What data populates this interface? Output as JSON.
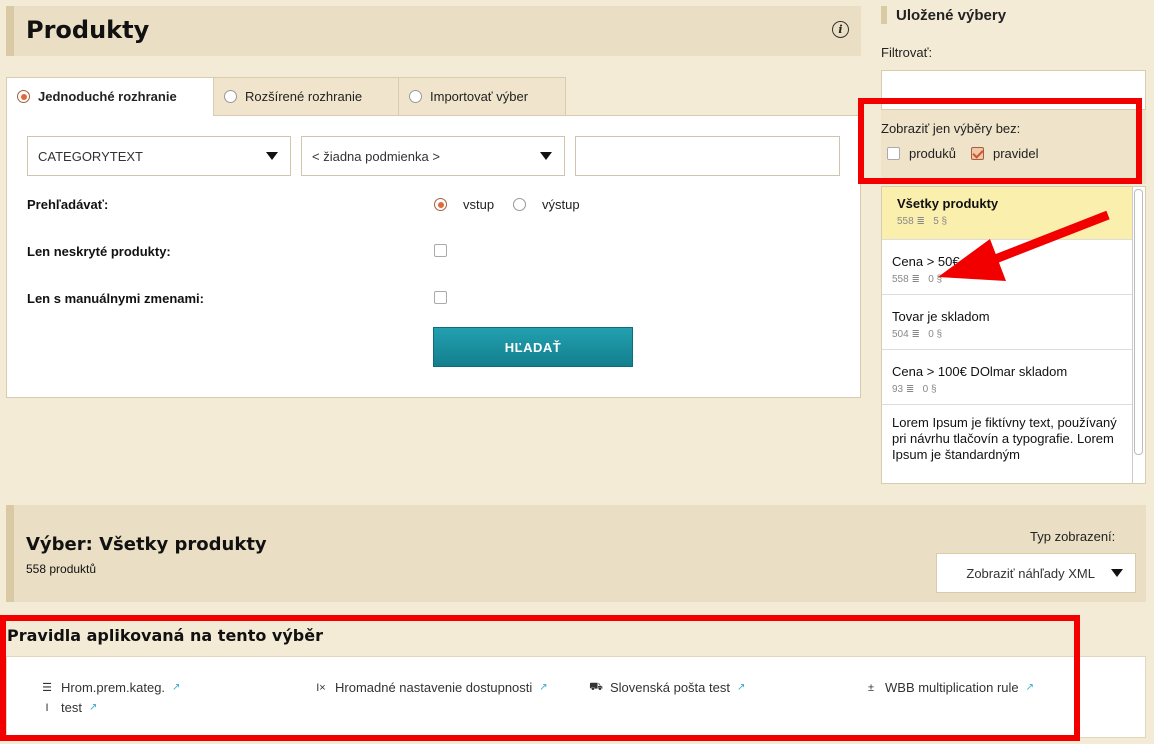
{
  "header": {
    "title": "Produkty"
  },
  "tabs": [
    {
      "label": "Jednoduché rozhranie",
      "active": true
    },
    {
      "label": "Rozšírené rozhranie",
      "active": false
    },
    {
      "label": "Importovať výber",
      "active": false
    }
  ],
  "search": {
    "field_select": "CATEGORYTEXT",
    "condition_select": "< žiadna podmienka >",
    "value_input": "",
    "browse_label": "Prehľadávať:",
    "browse_options": [
      {
        "label": "vstup",
        "selected": true
      },
      {
        "label": "výstup",
        "selected": false
      }
    ],
    "unhidden_label": "Len neskryté produkty:",
    "manual_label": "Len s manuálnymi zmenami:",
    "search_button": "HĽADAŤ"
  },
  "saved": {
    "title": "Uložené výbery",
    "filter_label": "Filtrovať:",
    "filter_value": "",
    "show_only_without_label": "Zobraziť jen výběry bez:",
    "without_options": [
      {
        "label": "produků",
        "checked": false
      },
      {
        "label": "pravidel",
        "checked": true
      }
    ],
    "items": [
      {
        "name": "Všetky produkty",
        "products": "558",
        "rules": "5",
        "selected": true
      },
      {
        "name": "Cena > 50€",
        "products": "558",
        "rules": "0",
        "selected": false
      },
      {
        "name": "Tovar je skladom",
        "products": "504",
        "rules": "0",
        "selected": false
      },
      {
        "name": "Cena > 100€ DOlmar skladom",
        "products": "93",
        "rules": "0",
        "selected": false
      },
      {
        "name": "Lorem Ipsum je fiktívny text, používaný pri návrhu tlačovín a typografie. Lorem Ipsum je štandardným",
        "products": "",
        "rules": "",
        "selected": false
      }
    ],
    "meta_icons": {
      "products": "≣",
      "rules": "§"
    }
  },
  "selection": {
    "title": "Výber: Všetky produkty",
    "count": "558 produktů",
    "view_type_label": "Typ zobrazení:",
    "view_type_value": "Zobraziť náhľady XML"
  },
  "rules": {
    "heading": "Pravidla aplikovaná na tento výběr",
    "items": [
      {
        "label": "Hrom.prem.kateg.",
        "icon": "list-icon",
        "glyph": "☰"
      },
      {
        "label": "Hromadné nastavenie dostupnosti",
        "icon": "text-clear-icon",
        "glyph": "I×"
      },
      {
        "label": "Slovenská pošta test",
        "icon": "truck-icon",
        "glyph": "⛟"
      },
      {
        "label": "WBB multiplication rule",
        "icon": "calculator-icon",
        "glyph": "±"
      },
      {
        "label": "test",
        "icon": "text-cursor-icon",
        "glyph": "I"
      }
    ]
  },
  "colors": {
    "accent": "#1a93a3",
    "highlight": "#fbefae",
    "annotation": "#f20000"
  }
}
